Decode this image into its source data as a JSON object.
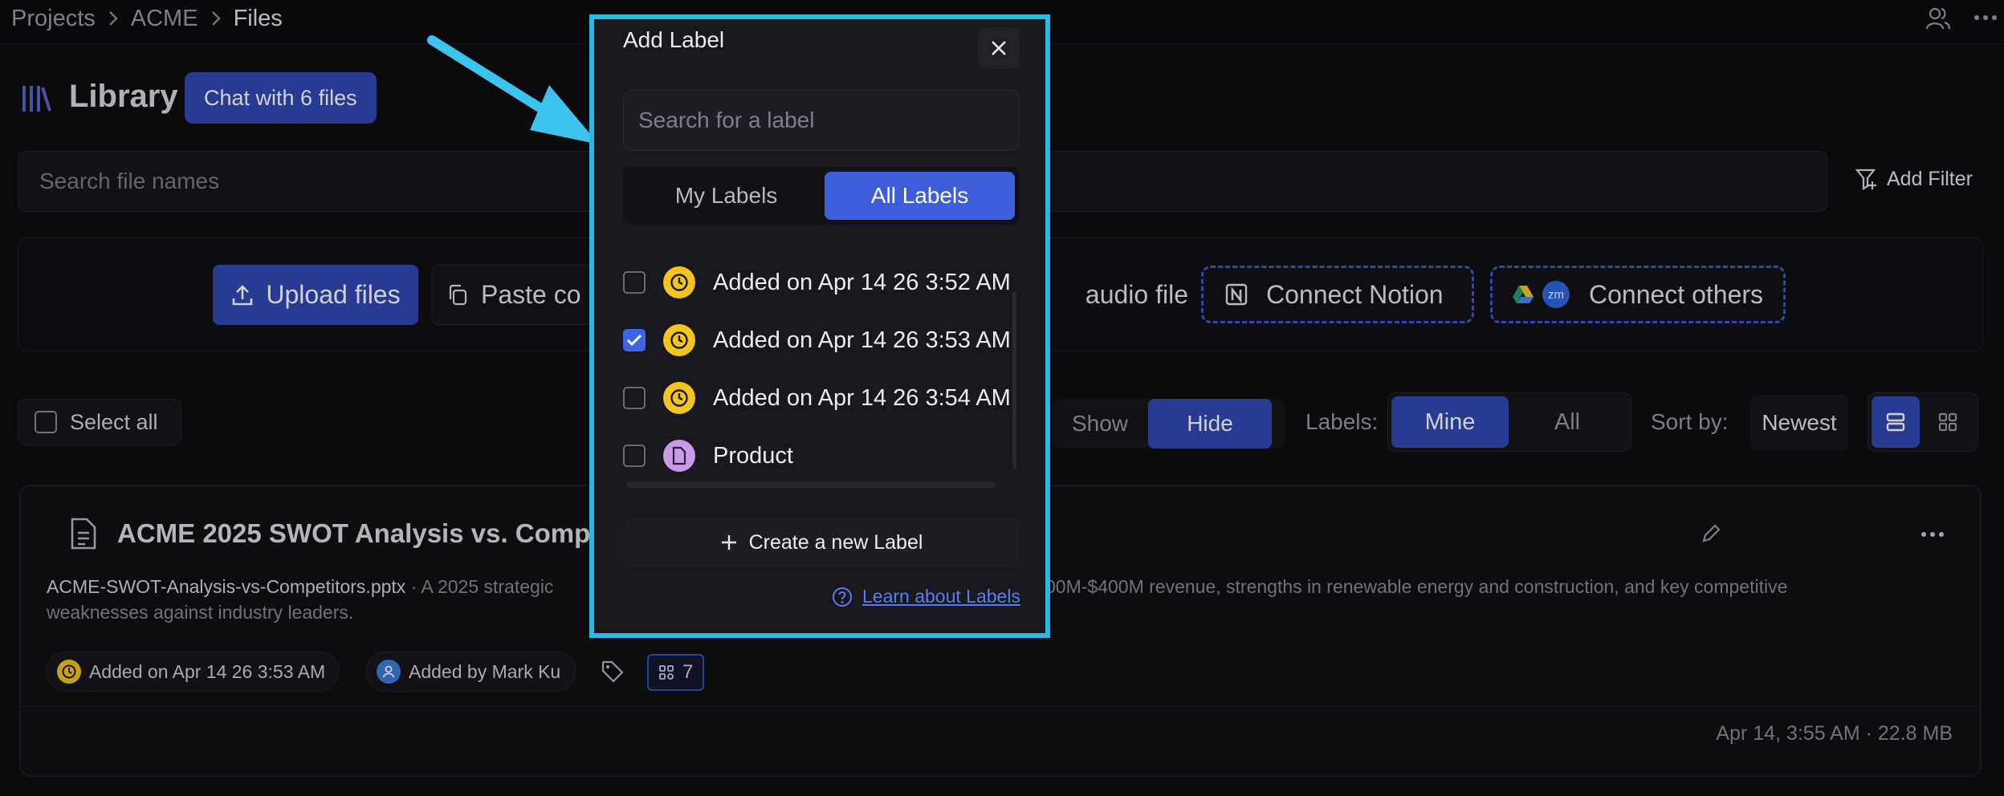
{
  "breadcrumb": {
    "items": [
      "Projects",
      "ACME",
      "Files"
    ]
  },
  "header": {
    "title": "Library",
    "chat_button": "Chat with 6 files"
  },
  "search": {
    "placeholder": "Search file names",
    "add_filter": "Add Filter"
  },
  "upload": {
    "upload_files": "Upload files",
    "paste_content": "Paste co",
    "audio_file": "audio file",
    "connect_notion": "Connect Notion",
    "connect_others": "Connect others",
    "zoom_badge": "zm"
  },
  "controls": {
    "select_all": "Select all",
    "show": "Show",
    "hide": "Hide",
    "labels_label": "Labels:",
    "mine": "Mine",
    "all": "All",
    "sort_by": "Sort by:",
    "sort_value": "Newest"
  },
  "file": {
    "title": "ACME 2025 SWOT Analysis vs. Competit",
    "filename": "ACME-SWOT-Analysis-vs-Competitors.pptx",
    "desc_start": " · A 2025 strategic",
    "desc_end": "00M-$400M revenue, strengths in renewable energy and construction, and key competitive",
    "desc_line2": "weaknesses against industry leaders.",
    "chip_added_on": "Added on Apr 14 26 3:53 AM",
    "chip_added_by": "Added by Mark Ku",
    "chip_count": "7",
    "meta": "Apr 14, 3:55 AM · 22.8 MB"
  },
  "modal": {
    "title": "Add Label",
    "search_placeholder": "Search for a label",
    "tab_mine": "My Labels",
    "tab_all": "All Labels",
    "labels": [
      {
        "text": "Added on Apr 14 26 3:52 AM",
        "checked": false,
        "icon": "clock-icon"
      },
      {
        "text": "Added on Apr 14 26 3:53 AM",
        "checked": true,
        "icon": "clock-icon"
      },
      {
        "text": "Added on Apr 14 26 3:54 AM",
        "checked": false,
        "icon": "clock-icon"
      },
      {
        "text": "Product",
        "checked": false,
        "icon": "document-icon"
      }
    ],
    "create_label": "Create a new Label",
    "learn_link": "Learn about Labels"
  },
  "colors": {
    "accent": "#3347b4",
    "highlight_border": "#29b9e5",
    "arrow": "#3cc3ee",
    "clock": "#f2c51d",
    "doc": "#c89be8"
  }
}
